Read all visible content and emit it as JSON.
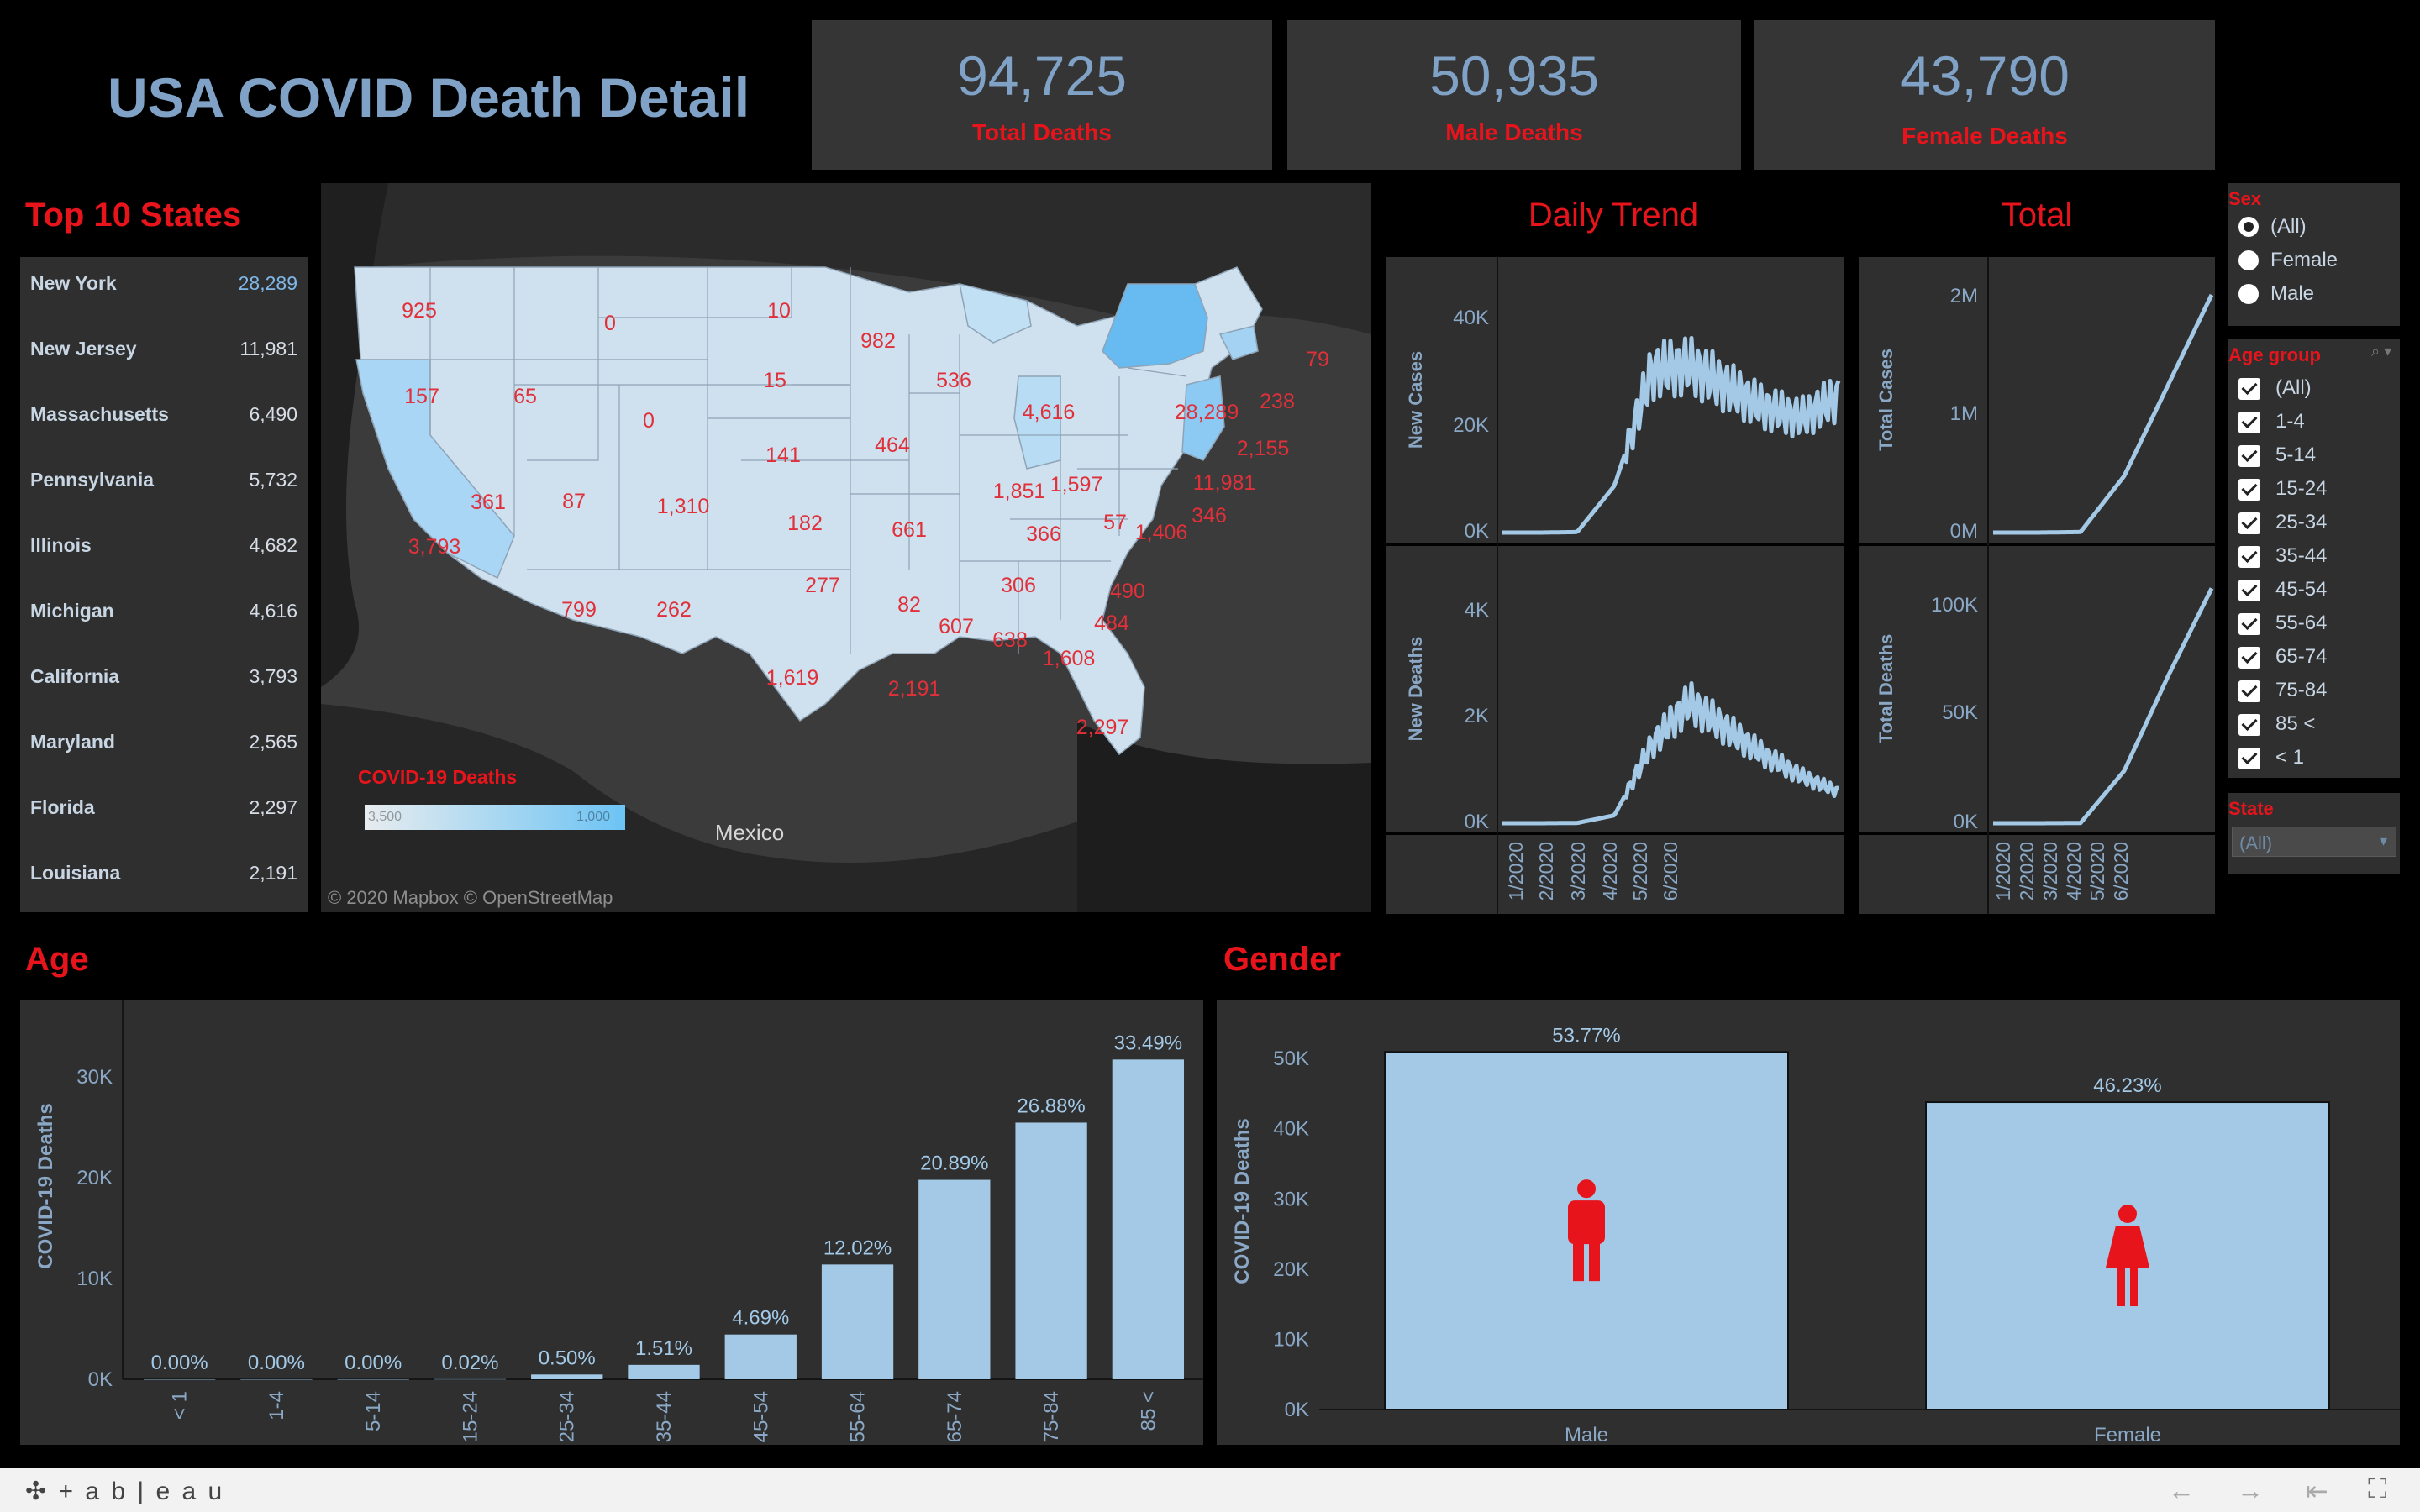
{
  "dashboard": {
    "title": "USA COVID Death Detail"
  },
  "kpis": [
    {
      "value": "94,725",
      "label": "Total Deaths"
    },
    {
      "value": "50,935",
      "label": "Male Deaths"
    },
    {
      "value": "43,790",
      "label": "Female Deaths"
    }
  ],
  "top_states": {
    "title": "Top 10 States",
    "rows": [
      {
        "state": "New York",
        "value": "28,289"
      },
      {
        "state": "New Jersey",
        "value": "11,981"
      },
      {
        "state": "Massachusetts",
        "value": "6,490"
      },
      {
        "state": "Pennsylvania",
        "value": "5,732"
      },
      {
        "state": "Illinois",
        "value": "4,682"
      },
      {
        "state": "Michigan",
        "value": "4,616"
      },
      {
        "state": "California",
        "value": "3,793"
      },
      {
        "state": "Maryland",
        "value": "2,565"
      },
      {
        "state": "Florida",
        "value": "2,297"
      },
      {
        "state": "Louisiana",
        "value": "2,191"
      }
    ]
  },
  "map": {
    "legend_title": "COVID-19 Deaths",
    "legend_min": "3,500",
    "legend_max": "1,000",
    "label_mexico": "Mexico",
    "attribution": "© 2020 Mapbox  © OpenStreetMap",
    "state_labels": [
      "925",
      "0",
      "10",
      "982",
      "157",
      "65",
      "0",
      "15",
      "536",
      "4,616",
      "28,289",
      "238",
      "79",
      "141",
      "464",
      "2,155",
      "361",
      "87",
      "1,310",
      "182",
      "1,851",
      "1,597",
      "11,981",
      "3,793",
      "661",
      "366",
      "57",
      "1,406",
      "346",
      "277",
      "82",
      "306",
      "490",
      "799",
      "262",
      "607",
      "638",
      "484",
      "1,619",
      "1,608",
      "2,191",
      "2,297"
    ]
  },
  "daily_trend": {
    "title": "Daily Trend",
    "top_ylabel": "New Cases",
    "top_ticks": [
      "40K",
      "20K",
      "0K"
    ],
    "bottom_ylabel": "New Deaths",
    "bottom_ticks": [
      "4K",
      "2K",
      "0K"
    ],
    "x_ticks": [
      "1/2020",
      "2/2020",
      "3/2020",
      "4/2020",
      "5/2020",
      "6/2020"
    ]
  },
  "total": {
    "title": "Total",
    "top_ylabel": "Total Cases",
    "top_ticks": [
      "2M",
      "1M",
      "0M"
    ],
    "bottom_ylabel": "Total Deaths",
    "bottom_ticks": [
      "100K",
      "50K",
      "0K"
    ],
    "x_ticks": [
      "1/2020",
      "2/2020",
      "3/2020",
      "4/2020",
      "5/2020",
      "6/2020"
    ]
  },
  "filters": {
    "sex": {
      "label": "Sex",
      "options": [
        "(All)",
        "Female",
        "Male"
      ],
      "selected": "(All)"
    },
    "age_group": {
      "label": "Age group",
      "options": [
        "(All)",
        "1-4",
        "5-14",
        "15-24",
        "25-34",
        "35-44",
        "45-54",
        "55-64",
        "65-74",
        "75-84",
        "85 <",
        "< 1"
      ]
    },
    "state": {
      "label": "State",
      "value": "(All)"
    }
  },
  "age": {
    "title": "Age"
  },
  "gender": {
    "title": "Gender"
  },
  "footer": {
    "brand": "+ a b | e a u"
  },
  "colors": {
    "accent_red": "#e8141c",
    "bar_blue": "#a3c9e6",
    "text_blue": "#7fa2c6",
    "panel": "#2f2f2f"
  },
  "chart_data": [
    {
      "type": "bar",
      "title": "Age",
      "ylabel": "COVID-19 Deaths",
      "categories": [
        "< 1",
        "1-4",
        "5-14",
        "15-24",
        "25-34",
        "35-44",
        "45-54",
        "55-64",
        "65-74",
        "75-84",
        "85 <"
      ],
      "values": [
        2,
        3,
        4,
        19,
        474,
        1430,
        4443,
        11387,
        19788,
        25462,
        31723
      ],
      "data_labels": [
        "0.00%",
        "0.00%",
        "0.00%",
        "0.02%",
        "0.50%",
        "1.51%",
        "4.69%",
        "12.02%",
        "20.89%",
        "26.88%",
        "33.49%"
      ],
      "yticks": [
        "0K",
        "10K",
        "20K",
        "30K"
      ],
      "ylim": [
        0,
        36000
      ]
    },
    {
      "type": "bar",
      "title": "Gender",
      "ylabel": "COVID-19 Deaths",
      "categories": [
        "Male",
        "Female"
      ],
      "values": [
        50935,
        43790
      ],
      "data_labels": [
        "53.77%",
        "46.23%"
      ],
      "yticks": [
        "0K",
        "10K",
        "20K",
        "30K",
        "40K",
        "50K"
      ],
      "ylim": [
        0,
        56000
      ]
    },
    {
      "type": "line",
      "title": "Daily Trend",
      "ylabel": "New Cases",
      "x": [
        "1/2020",
        "2/2020",
        "3/2020",
        "3/15/2020",
        "4/2020",
        "4/15/2020",
        "5/2020",
        "5/15/2020",
        "6/2020",
        "6/15/2020"
      ],
      "values": [
        0,
        0,
        100,
        9000,
        31000,
        32000,
        28000,
        24000,
        22000,
        26000
      ],
      "ylim": [
        0,
        50000
      ]
    },
    {
      "type": "line",
      "ylabel": "New Deaths",
      "x": [
        "1/2020",
        "2/2020",
        "3/2020",
        "3/15/2020",
        "4/2020",
        "4/15/2020",
        "5/2020",
        "5/15/2020",
        "6/2020",
        "6/15/2020"
      ],
      "values": [
        0,
        0,
        5,
        150,
        1500,
        2300,
        1800,
        1300,
        900,
        600
      ],
      "ylim": [
        0,
        5000
      ]
    },
    {
      "type": "line",
      "title": "Total",
      "ylabel": "Total Cases",
      "x": [
        "1/2020",
        "2/2020",
        "3/2020",
        "4/2020",
        "5/2020",
        "6/2020"
      ],
      "values": [
        0,
        0,
        5000,
        500000,
        1300000,
        2100000
      ],
      "ylim": [
        0,
        2300000
      ]
    },
    {
      "type": "line",
      "ylabel": "Total Deaths",
      "x": [
        "1/2020",
        "2/2020",
        "3/2020",
        "4/2020",
        "5/2020",
        "6/2020"
      ],
      "values": [
        0,
        0,
        100,
        25000,
        70000,
        112000
      ],
      "ylim": [
        0,
        125000
      ]
    }
  ]
}
